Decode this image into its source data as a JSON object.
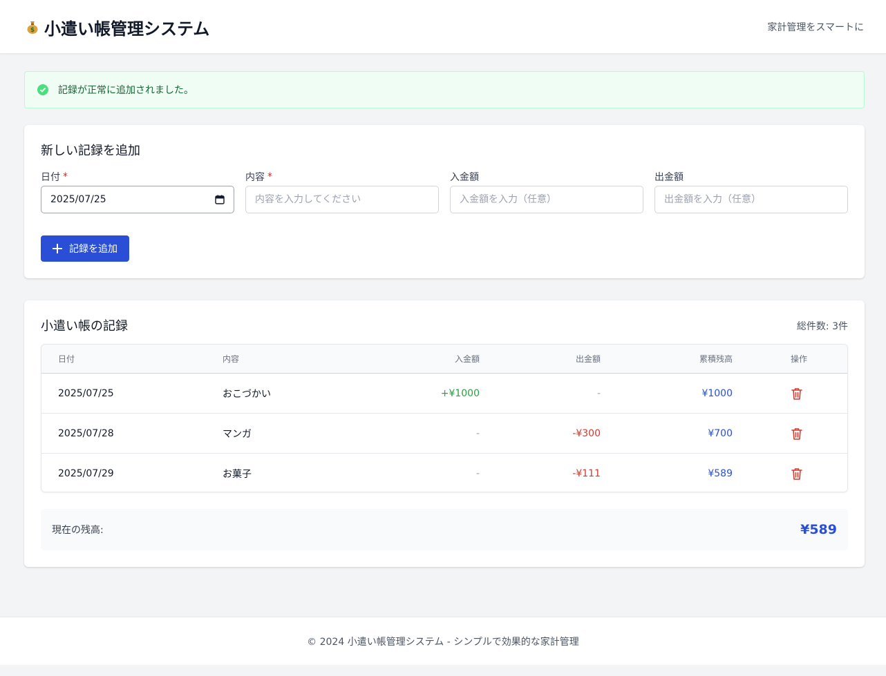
{
  "header": {
    "title": "小遣い帳管理システム",
    "tagline": "家計管理をスマートに",
    "icon": "money-bag-icon"
  },
  "alert": {
    "message": "記録が正常に追加されました。",
    "icon": "check-circle-icon",
    "color": "#4ade80"
  },
  "form": {
    "title": "新しい記録を追加",
    "date_label": "日付",
    "desc_label": "内容",
    "income_label": "入金額",
    "expense_label": "出金額",
    "required_mark": "*",
    "date_value": "2025/07/25",
    "desc_placeholder": "内容を入力してください",
    "income_placeholder": "入金額を入力（任意）",
    "expense_placeholder": "出金額を入力（任意）",
    "submit_label": "記録を追加",
    "accent": "#2a4fd6"
  },
  "records": {
    "title": "小遣い帳の記録",
    "total_count": "総件数: 3件",
    "columns": [
      "日付",
      "内容",
      "入金額",
      "出金額",
      "累積残高",
      "操作"
    ],
    "rows": [
      {
        "date": "2025/07/25",
        "desc": "おこづかい",
        "income": "+¥1000",
        "expense": "-",
        "balance": "¥1000"
      },
      {
        "date": "2025/07/28",
        "desc": "マンガ",
        "income": "-",
        "expense": "-¥300",
        "balance": "¥700"
      },
      {
        "date": "2025/07/29",
        "desc": "お菓子",
        "income": "-",
        "expense": "-¥111",
        "balance": "¥589"
      }
    ],
    "delete_icon": "trash-icon",
    "current_balance_label": "現在の残高:",
    "current_balance_value": "¥589"
  },
  "footer": {
    "text": "© 2024 小遣い帳管理システム - シンプルで効果的な家計管理"
  },
  "colors": {
    "income": "#2f9e44",
    "expense": "#d13b2e",
    "balance": "#2a4fd6"
  }
}
